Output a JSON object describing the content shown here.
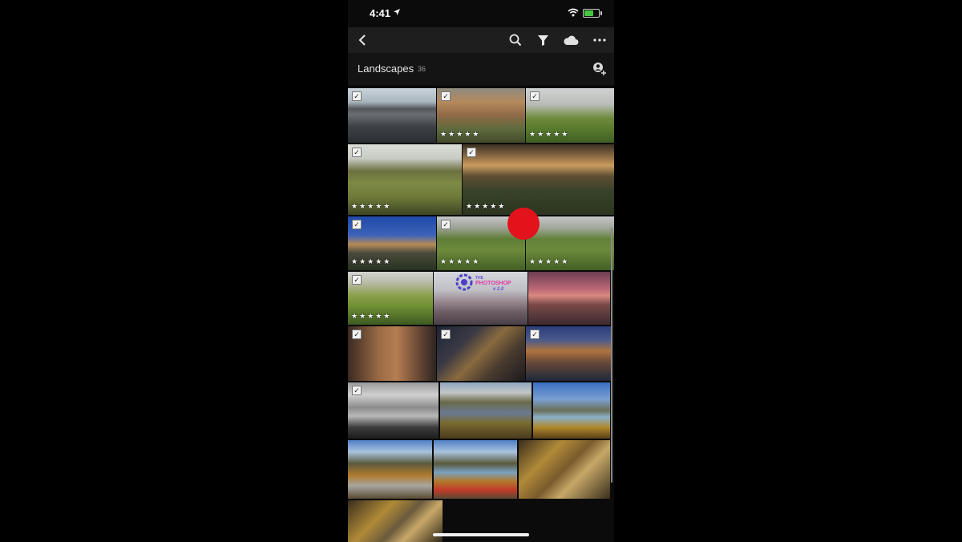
{
  "status": {
    "time": "4:41"
  },
  "toolbar": {
    "back_icon": "chevron-left-icon",
    "search_icon": "search-icon",
    "filter_icon": "filter-icon",
    "cloud_icon": "cloud-icon",
    "more_icon": "more-icon"
  },
  "album": {
    "title": "Landscapes",
    "count": "36"
  },
  "overlay": {
    "logo_small": "THE",
    "logo_main": "PHOTOSHOP",
    "logo_sub": "v 2.0"
  },
  "photo_rating": "★★★★★",
  "check": "✓",
  "colors": {
    "tap_indicator": "#e3131b",
    "toolbar": "#1e1e1e",
    "background": "#0b0b0b"
  }
}
